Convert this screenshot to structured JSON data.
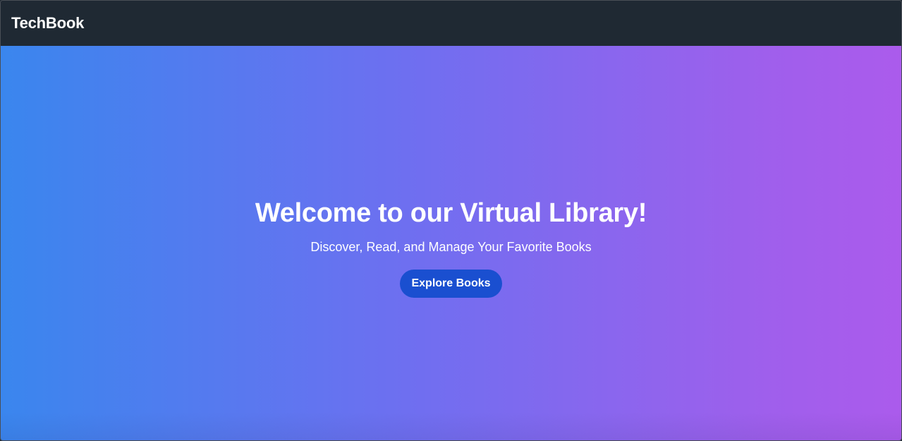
{
  "navbar": {
    "brand": "TechBook"
  },
  "hero": {
    "title": "Welcome to our Virtual Library!",
    "subtitle": "Discover, Read, and Manage Your Favorite Books",
    "cta_label": "Explore Books"
  },
  "colors": {
    "navbar_bg": "#1f2933",
    "gradient_start": "#3a86ee",
    "gradient_end": "#ab5bec",
    "cta_bg": "#1a4fd0",
    "text": "#ffffff"
  }
}
